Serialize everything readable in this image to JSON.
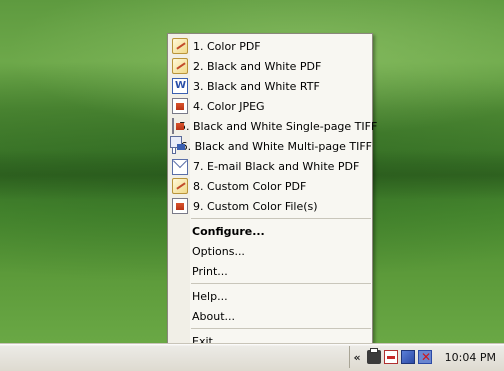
{
  "menu": {
    "items": [
      {
        "label": "1. Color PDF",
        "icon": "pdf-icon"
      },
      {
        "label": "2. Black and White PDF",
        "icon": "pdf-icon"
      },
      {
        "label": "3. Black and White RTF",
        "icon": "rtf-icon"
      },
      {
        "label": "4. Color JPEG",
        "icon": "image-icon"
      },
      {
        "label": "5. Black and White Single-page TIFF",
        "icon": "image-icon"
      },
      {
        "label": "6. Black and White Multi-page TIFF",
        "icon": "multipage-icon"
      },
      {
        "label": "7. E-mail Black and White PDF",
        "icon": "mail-icon"
      },
      {
        "label": "8. Custom Color PDF",
        "icon": "pdf-icon"
      },
      {
        "label": "9. Custom Color File(s)",
        "icon": "image-icon"
      }
    ],
    "configure": "Configure...",
    "options": "Options...",
    "print": "Print...",
    "help": "Help...",
    "about": "About...",
    "exit": "Exit..."
  },
  "taskbar": {
    "chevron": "«",
    "clock": "10:04 PM",
    "tray_icons": [
      "printer-icon",
      "pdf-tray-icon",
      "network-icon",
      "volume-muted-icon"
    ]
  }
}
